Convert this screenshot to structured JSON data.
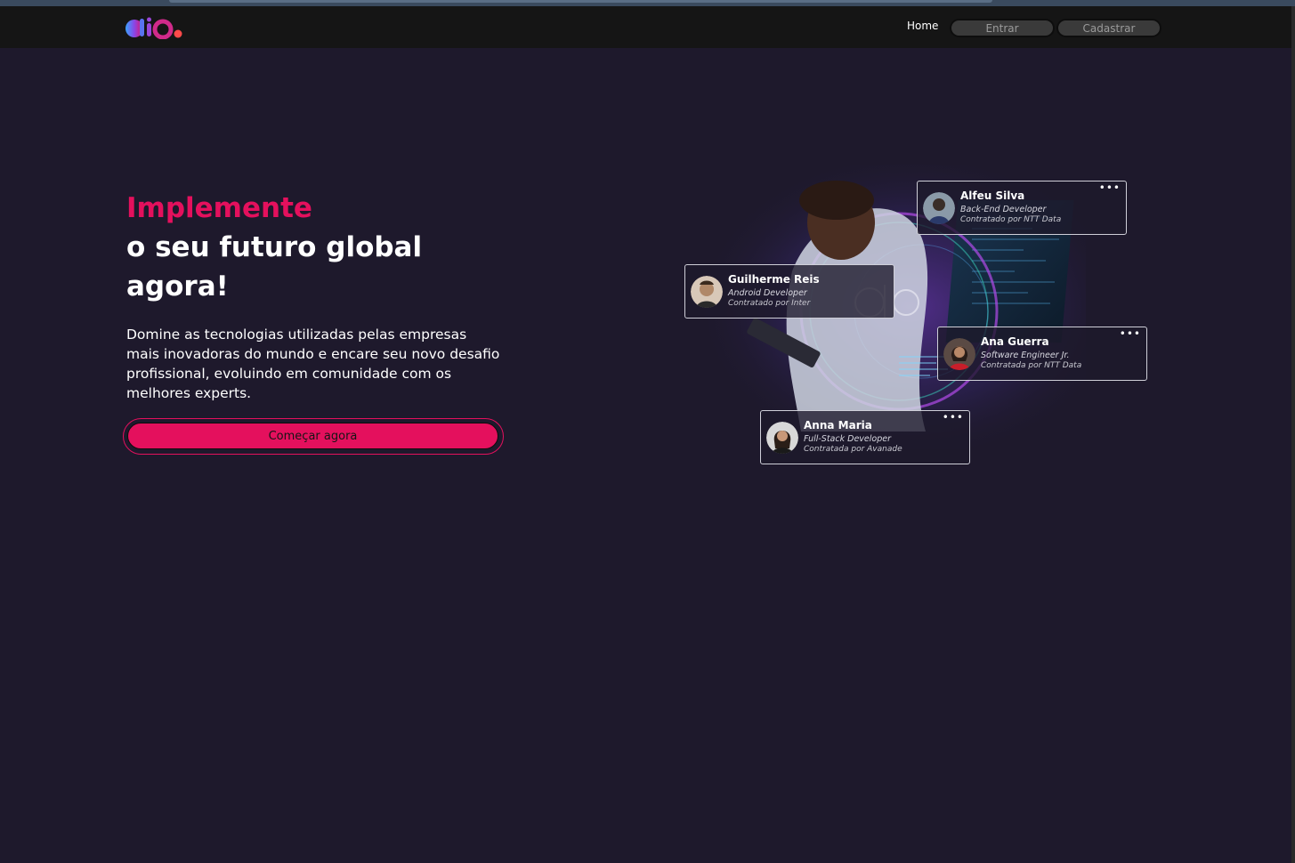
{
  "nav": {
    "logo_text": "dio.",
    "home": "Home",
    "entrar": "Entrar",
    "cadastrar": "Cadastrar"
  },
  "hero": {
    "title_accent": "Implemente",
    "title_line2": "o seu futuro global",
    "title_line3": "agora!",
    "description": "Domine as tecnologias utilizadas pelas empresas mais inovadoras do mundo e encare seu novo desafio profissional, evoluindo em comunidade com os melhores experts.",
    "cta": "Começar agora"
  },
  "cards": [
    {
      "name": "Alfeu Silva",
      "role": "Back-End Developer",
      "company": "Contratado por NTT Data",
      "menu": "•••"
    },
    {
      "name": "Guilherme Reis",
      "role": "Android Developer",
      "company": "Contratado por Inter"
    },
    {
      "name": "Ana Guerra",
      "role": "Software Engineer Jr.",
      "company": "Contratada por NTT Data",
      "menu": "•••"
    },
    {
      "name": "Anna Maria",
      "role": "Full-Stack Developer",
      "company": "Contratada por Avanade",
      "menu": "•••"
    }
  ],
  "colors": {
    "accent": "#e4105d",
    "background": "#1e192c",
    "navbar": "#151515"
  },
  "icons": {
    "menu": "more-dots-icon",
    "logo": "dio-logo"
  }
}
